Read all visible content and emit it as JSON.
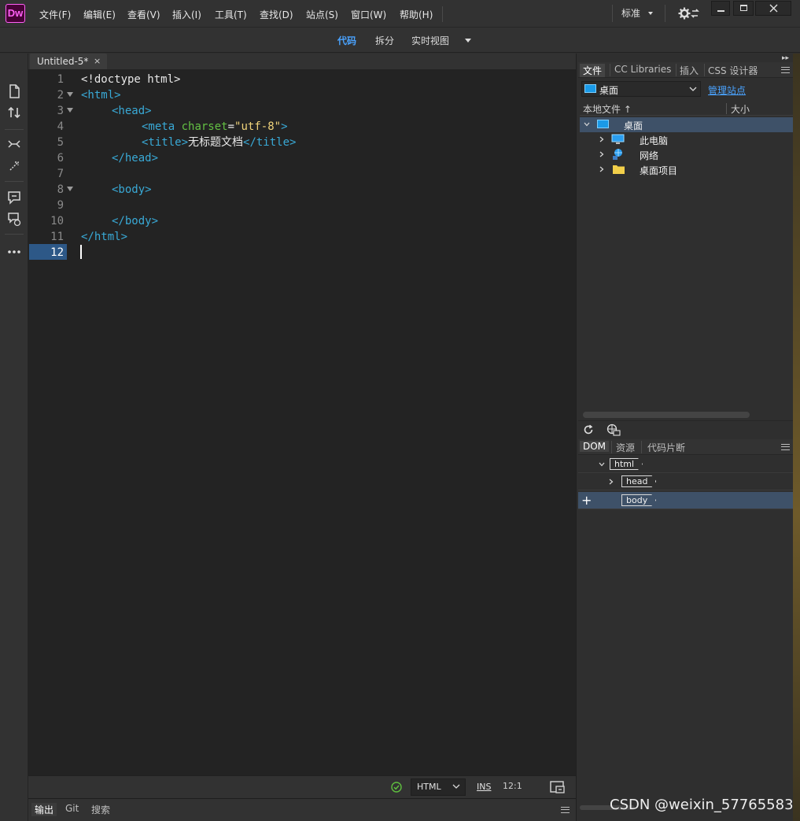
{
  "app": {
    "logo": "Dw"
  },
  "menu": {
    "items": [
      "文件(F)",
      "编辑(E)",
      "查看(V)",
      "插入(I)",
      "工具(T)",
      "查找(D)",
      "站点(S)",
      "窗口(W)",
      "帮助(H)"
    ],
    "workspace": "标准"
  },
  "view_switcher": {
    "code": "代码",
    "split": "拆分",
    "live": "实时视图"
  },
  "document": {
    "tab_title": "Untitled-5*",
    "close_glyph": "×",
    "line_numbers": [
      "1",
      "2",
      "3",
      "4",
      "5",
      "6",
      "7",
      "8",
      "9",
      "10",
      "11",
      "12"
    ],
    "current_line": "12",
    "lines": {
      "l1": "<!doctype html>",
      "l2": "<html>",
      "l3": "<head>",
      "l4_tag_open": "<meta",
      "l4_attr": "charset",
      "l4_eq": "=",
      "l4_val": "\"utf-8\"",
      "l4_close": ">",
      "l5_open": "<title>",
      "l5_text": "无标题文档",
      "l5_close": "</title>",
      "l6": "</head>",
      "l8": "<body>",
      "l10": "</body>",
      "l11": "</html>"
    }
  },
  "statusbar": {
    "doc_type": "HTML",
    "insert_mode": "INS",
    "cursor_position": "12:1"
  },
  "output_panel": {
    "tabs": [
      "输出",
      "Git",
      "搜索"
    ]
  },
  "files_panel": {
    "tabs": [
      "文件",
      "CC Libraries",
      "插入",
      "CSS 设计器"
    ],
    "site": "桌面",
    "manage_sites": "管理站点",
    "col_local": "本地文件",
    "col_size": "大小",
    "tree": {
      "root": "桌面",
      "children": [
        "此电脑",
        "网络",
        "桌面项目"
      ]
    }
  },
  "dom_panel": {
    "tabs": [
      "DOM",
      "资源",
      "代码片断"
    ],
    "nodes": [
      "html",
      "head",
      "body"
    ]
  },
  "watermark": "CSDN @weixin_57765583",
  "colors": {
    "accent": "#4aa3ff",
    "tag": "#39a9d6",
    "attr": "#63c043",
    "string": "#f0d37a",
    "selection": "#3e5168",
    "logo": "#ff61f6"
  }
}
